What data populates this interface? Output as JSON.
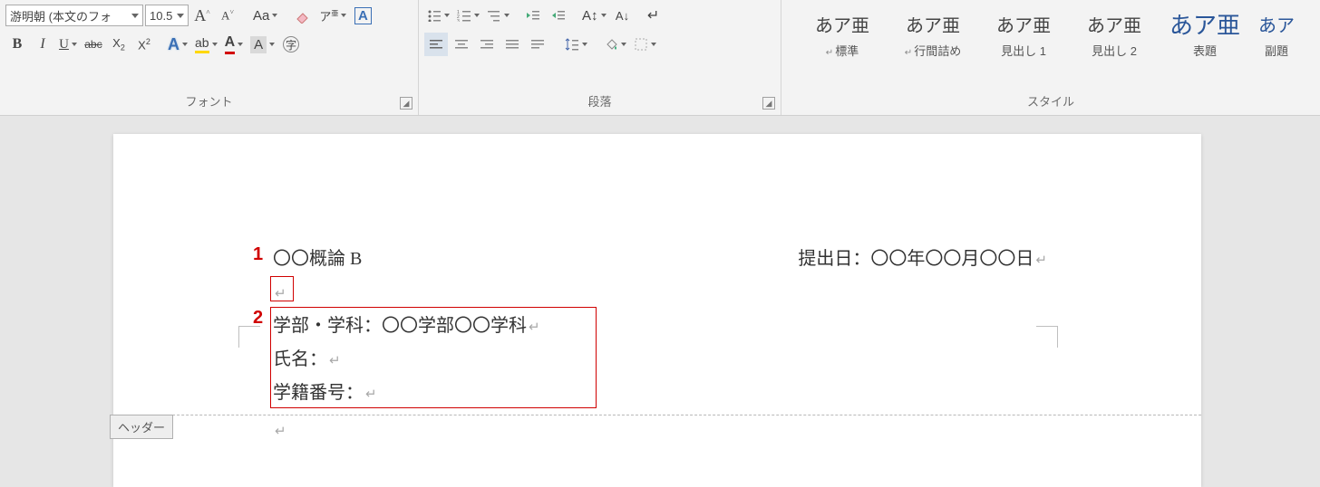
{
  "ribbon": {
    "font": {
      "name": "游明朝 (本文のフォ",
      "size": "10.5",
      "group_label": "フォント"
    },
    "paragraph": {
      "group_label": "段落"
    },
    "styles": {
      "group_label": "スタイル",
      "items": [
        {
          "preview": "あア亜",
          "name": "標準",
          "para": true
        },
        {
          "preview": "あア亜",
          "name": "行間詰め",
          "para": true
        },
        {
          "preview": "あア亜",
          "name": "見出し 1"
        },
        {
          "preview": "あア亜",
          "name": "見出し 2"
        },
        {
          "preview": "あア亜",
          "name": "表題",
          "big": true
        },
        {
          "preview": "あア",
          "name": "副題",
          "cut": true
        }
      ]
    }
  },
  "doc": {
    "line1_left": "〇〇概論 B",
    "line1_right": "提出日：〇〇年〇〇月〇〇日",
    "line3": "学部・学科：〇〇学部〇〇学科",
    "line4": "氏名：",
    "line5": "学籍番号：",
    "header_label": "ヘッダー"
  },
  "annotations": {
    "a1": "1",
    "a2": "2"
  }
}
